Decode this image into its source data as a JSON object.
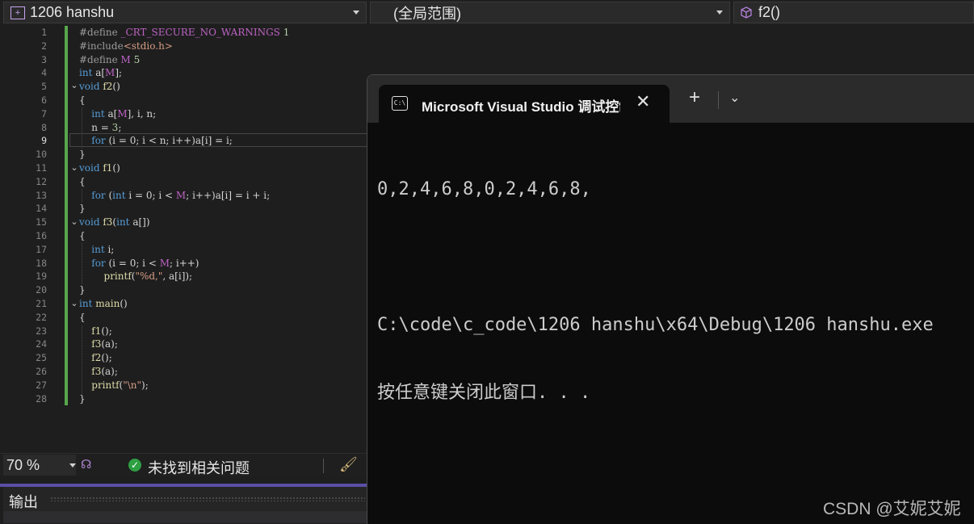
{
  "navbar": {
    "project": "1206 hanshu",
    "scope": "(全局范围)",
    "member": "f2()"
  },
  "editor": {
    "line_numbers": [
      "1",
      "2",
      "3",
      "4",
      "5",
      "6",
      "7",
      "8",
      "9",
      "10",
      "11",
      "12",
      "13",
      "14",
      "15",
      "16",
      "17",
      "18",
      "19",
      "20",
      "21",
      "22",
      "23",
      "24",
      "25",
      "26",
      "27",
      "28"
    ],
    "current_line": "9",
    "lines": [
      [
        {
          "t": "#define ",
          "c": "pp"
        },
        {
          "t": "_CRT_SECURE_NO_WARNINGS ",
          "c": "mac"
        },
        {
          "t": "1",
          "c": "num"
        }
      ],
      [
        {
          "t": "#include",
          "c": "pp"
        },
        {
          "t": "<stdio.h>",
          "c": "str"
        }
      ],
      [
        {
          "t": "#define ",
          "c": "pp"
        },
        {
          "t": "M ",
          "c": "mac"
        },
        {
          "t": "5",
          "c": "num"
        }
      ],
      [
        {
          "t": "int ",
          "c": "kw"
        },
        {
          "t": "a[",
          "c": ""
        },
        {
          "t": "M",
          "c": "mac"
        },
        {
          "t": "];",
          "c": ""
        }
      ],
      [
        {
          "t": "void ",
          "c": "kw"
        },
        {
          "t": "f2",
          "c": "fn"
        },
        {
          "t": "()",
          "c": ""
        }
      ],
      [
        {
          "t": "{",
          "c": ""
        }
      ],
      [
        {
          "t": "    int ",
          "c": "kw"
        },
        {
          "t": "a[",
          "c": ""
        },
        {
          "t": "M",
          "c": "mac"
        },
        {
          "t": "], i, n;",
          "c": ""
        }
      ],
      [
        {
          "t": "    n = ",
          "c": ""
        },
        {
          "t": "3",
          "c": "num"
        },
        {
          "t": ";",
          "c": ""
        }
      ],
      [
        {
          "t": "    for ",
          "c": "kw"
        },
        {
          "t": "(i = 0; i < n; i++)a[i] = i;",
          "c": ""
        }
      ],
      [
        {
          "t": "}",
          "c": ""
        }
      ],
      [
        {
          "t": "void ",
          "c": "kw"
        },
        {
          "t": "f1",
          "c": "fn"
        },
        {
          "t": "()",
          "c": ""
        }
      ],
      [
        {
          "t": "{",
          "c": ""
        }
      ],
      [
        {
          "t": "    for ",
          "c": "kw"
        },
        {
          "t": "(",
          "c": ""
        },
        {
          "t": "int ",
          "c": "kw"
        },
        {
          "t": "i = 0; i < ",
          "c": ""
        },
        {
          "t": "M",
          "c": "mac"
        },
        {
          "t": "; i++)a[i] = i + i;",
          "c": ""
        }
      ],
      [
        {
          "t": "}",
          "c": ""
        }
      ],
      [
        {
          "t": "void ",
          "c": "kw"
        },
        {
          "t": "f3",
          "c": "fn"
        },
        {
          "t": "(",
          "c": ""
        },
        {
          "t": "int ",
          "c": "kw"
        },
        {
          "t": "a[])",
          "c": ""
        }
      ],
      [
        {
          "t": "{",
          "c": ""
        }
      ],
      [
        {
          "t": "    int ",
          "c": "kw"
        },
        {
          "t": "i;",
          "c": ""
        }
      ],
      [
        {
          "t": "    for ",
          "c": "kw"
        },
        {
          "t": "(i = 0; i < ",
          "c": ""
        },
        {
          "t": "M",
          "c": "mac"
        },
        {
          "t": "; i++)",
          "c": ""
        }
      ],
      [
        {
          "t": "        printf",
          "c": "fn"
        },
        {
          "t": "(",
          "c": ""
        },
        {
          "t": "\"%d,\"",
          "c": "str"
        },
        {
          "t": ", a[i]);",
          "c": ""
        }
      ],
      [
        {
          "t": "}",
          "c": ""
        }
      ],
      [
        {
          "t": "int ",
          "c": "kw"
        },
        {
          "t": "main",
          "c": "fn"
        },
        {
          "t": "()",
          "c": ""
        }
      ],
      [
        {
          "t": "{",
          "c": ""
        }
      ],
      [
        {
          "t": "    f1",
          "c": "fn"
        },
        {
          "t": "();",
          "c": ""
        }
      ],
      [
        {
          "t": "    f3",
          "c": "fn"
        },
        {
          "t": "(a);",
          "c": ""
        }
      ],
      [
        {
          "t": "    f2",
          "c": "fn"
        },
        {
          "t": "();",
          "c": ""
        }
      ],
      [
        {
          "t": "    f3",
          "c": "fn"
        },
        {
          "t": "(a);",
          "c": ""
        }
      ],
      [
        {
          "t": "    printf",
          "c": "fn"
        },
        {
          "t": "(",
          "c": ""
        },
        {
          "t": "\"\\n\"",
          "c": "str"
        },
        {
          "t": ");",
          "c": ""
        }
      ],
      [
        {
          "t": "}",
          "c": ""
        }
      ]
    ]
  },
  "status": {
    "zoom": "70 %",
    "issues": "未找到相关问题"
  },
  "output_panel": {
    "title": "输出"
  },
  "console": {
    "tab_title": "Microsoft Visual Studio 调试控制台",
    "output_line": "0,2,4,6,8,0,2,4,6,8,",
    "path_line": "C:\\code\\c_code\\1206 hanshu\\x64\\Debug\\1206 hanshu.exe",
    "prompt_line": "按任意键关闭此窗口. . ."
  },
  "watermark": "CSDN @艾妮艾妮"
}
